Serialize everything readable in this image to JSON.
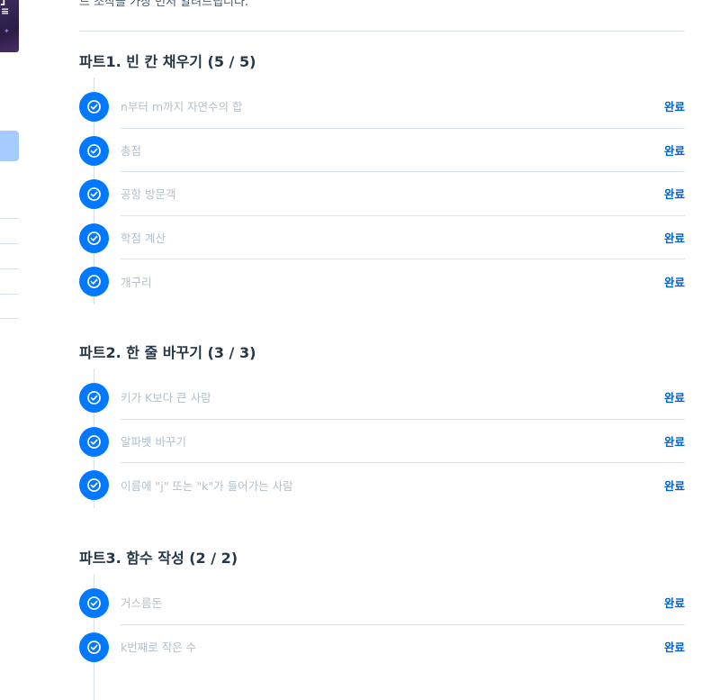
{
  "intro": {
    "text": "드 조작을 가장 먼저 알려드립니다."
  },
  "parts": [
    {
      "title": "파트1. 빈 칸 채우기 (5 / 5)",
      "lessons": [
        {
          "title": "n부터 m까지 자연수의 합",
          "status": "완료"
        },
        {
          "title": "총점",
          "status": "완료"
        },
        {
          "title": "공항 방문객",
          "status": "완료"
        },
        {
          "title": "학점 계산",
          "status": "완료"
        },
        {
          "title": "개구리",
          "status": "완료"
        }
      ]
    },
    {
      "title": "파트2. 한 줄 바꾸기 (3 / 3)",
      "lessons": [
        {
          "title": "키가 K보다 큰 사람",
          "status": "완료"
        },
        {
          "title": "알파벳 바꾸기",
          "status": "완료"
        },
        {
          "title": "이름에 \"j\" 또는 \"k\"가 들어가는 사람",
          "status": "완료"
        }
      ]
    },
    {
      "title": "파트3. 함수 작성 (2 / 2)",
      "lessons": [
        {
          "title": "거스름돈",
          "status": "완료"
        },
        {
          "title": "k번째로 작은 수",
          "status": "완료"
        }
      ]
    }
  ],
  "icons": {
    "lesson_done": "check-circle-icon"
  },
  "colors": {
    "accent": "#0078ff",
    "status_text": "#0062d1",
    "lesson_text": "#b2c0cc"
  }
}
